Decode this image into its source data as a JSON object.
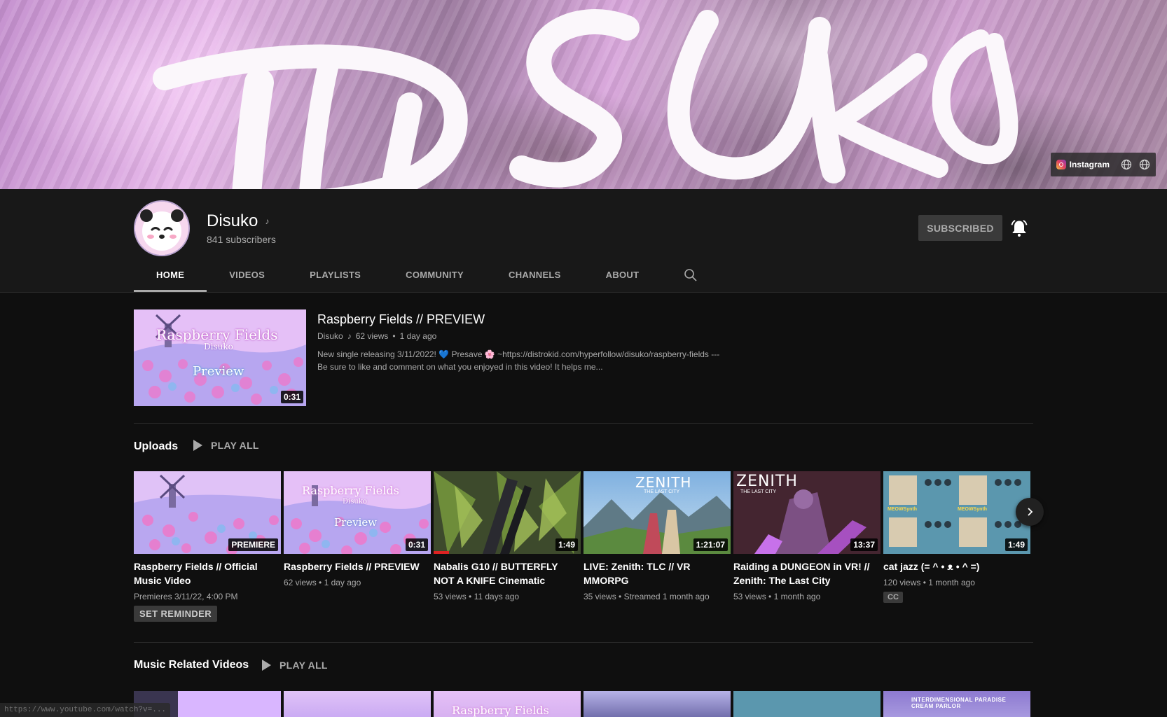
{
  "banner": {
    "logo_text": "DISUKO",
    "links": {
      "instagram": "Instagram"
    }
  },
  "channel": {
    "name": "Disuko",
    "subscribers": "841 subscribers",
    "subscribe_label": "SUBSCRIBED"
  },
  "tabs": [
    "HOME",
    "VIDEOS",
    "PLAYLISTS",
    "COMMUNITY",
    "CHANNELS",
    "ABOUT"
  ],
  "featured": {
    "title": "Raspberry Fields // PREVIEW",
    "channel": "Disuko",
    "views": "62 views",
    "age": "1 day ago",
    "duration": "0:31",
    "thumb_title": "Raspberry Fields",
    "thumb_sub": "Disuko",
    "thumb_tag": "Preview",
    "description_line1": "New single releasing 3/11/2022! 💙 Presave 🌸 ~https://distrokid.com/hyperfollow/disuko/raspberry-fields ---",
    "description_line2": "Be sure to like and comment on what you enjoyed in this video! It helps me..."
  },
  "uploads": {
    "title": "Uploads",
    "play_all": "PLAY ALL",
    "videos": [
      {
        "title": "Raspberry Fields // Official Music Video",
        "badge": "PREMIERE",
        "meta": "Premieres 3/11/22, 4:00 PM",
        "action": "SET REMINDER"
      },
      {
        "title": "Raspberry Fields // PREVIEW",
        "duration": "0:31",
        "views": "62 views",
        "age": "1 day ago",
        "thumb_title": "Raspberry Fields",
        "thumb_sub": "Disuko",
        "thumb_tag": "Preview"
      },
      {
        "title": "Nabalis G10 // BUTTERFLY NOT A KNIFE Cinematic",
        "duration": "1:49",
        "views": "53 views",
        "age": "11 days ago"
      },
      {
        "title": "LIVE: Zenith: TLC // VR MMORPG",
        "duration": "1:21:07",
        "views": "35 views",
        "age": "Streamed 1 month ago",
        "thumb_title": "ZENITH",
        "thumb_sub": "THE LAST CITY"
      },
      {
        "title": "Raiding a DUNGEON in VR! // Zenith: The Last City",
        "duration": "13:37",
        "views": "53 views",
        "age": "1 month ago",
        "thumb_title": "ZENITH",
        "thumb_sub": "THE LAST CITY"
      },
      {
        "title": "cat jazz (= ^ • ᴥ • ^ =)",
        "duration": "1:49",
        "views": "120 views",
        "age": "1 month ago",
        "badge": "CC",
        "thumb_label": "MEOWSynth"
      }
    ]
  },
  "music": {
    "title": "Music Related Videos",
    "play_all": "PLAY ALL",
    "thumb_title": "Raspberry Fields",
    "thumb_label": "INTERDIMENSIONAL PARADISE CREAM PARLOR"
  },
  "status_url": "https://www.youtube.com/watch?v=..."
}
